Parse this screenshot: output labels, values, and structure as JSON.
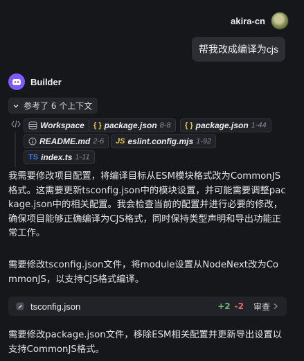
{
  "user": {
    "name": "akira-cn",
    "message": "帮我改成编译为cjs"
  },
  "assistant": {
    "name": "Builder"
  },
  "context": {
    "toggle_label": "参考了 6 个上下文",
    "refs": [
      {
        "name": "Workspace",
        "range": "",
        "icon": "workspace-icon"
      },
      {
        "name": "package.json",
        "range": "8-8",
        "icon": "json-braces-icon"
      },
      {
        "name": "package.json",
        "range": "1-44",
        "icon": "json-braces-icon"
      },
      {
        "name": "README.md",
        "range": "2-6",
        "icon": "markdown-info-icon"
      },
      {
        "name": "eslint.config.mjs",
        "range": "1-92",
        "icon": "javascript-icon",
        "badge": "JS"
      },
      {
        "name": "index.ts",
        "range": "1-11",
        "icon": "typescript-icon",
        "badge": "TS"
      }
    ]
  },
  "messages": {
    "p1": "我需要修改项目配置，将编译目标从ESM模块格式改为CommonJS格式。这需要更新tsconfig.json中的模块设置，并可能需要调整package.json中的相关配置。我会检查当前的配置并进行必要的修改，确保项目能够正确编译为CJS格式，同时保持类型声明和导出功能正常工作。",
    "p2": "需要修改tsconfig.json文件，将module设置从NodeNext改为CommonJS，以支持CJS格式编译。",
    "p3": "需要修改package.json文件，移除ESM相关配置并更新导出设置以支持CommonJS格式。"
  },
  "file_change": {
    "filename": "tsconfig.json",
    "additions": "+2",
    "deletions": "-2",
    "review_label": "审查"
  },
  "colors": {
    "background": "#16171b",
    "accent": "#7c5cff",
    "add": "#5fbf72",
    "del": "#e06b6b"
  }
}
